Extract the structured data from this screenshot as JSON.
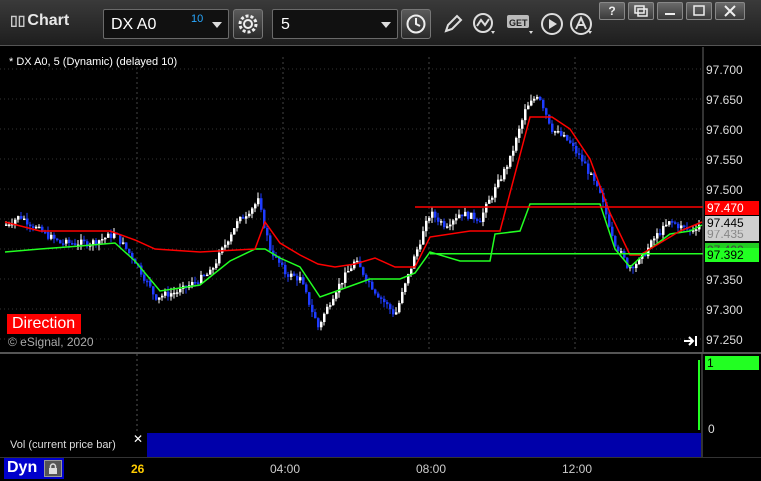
{
  "window": {
    "title": "Chart",
    "symbol": "DX A0",
    "symbol_superscript": "10",
    "interval": "5",
    "controls": [
      "minimize",
      "restore",
      "maximize",
      "close"
    ]
  },
  "toolbar_icons": [
    "settings-gear",
    "clock",
    "pencil",
    "indicator",
    "get",
    "play",
    "font"
  ],
  "get_label": "GET",
  "chart": {
    "legend": "* DX A0, 5 (Dynamic) (delayed 10)",
    "study_label": "Direction",
    "copyright": "© eSignal, 2020",
    "price_axis": [
      "97.700",
      "97.650",
      "97.600",
      "97.550",
      "97.500",
      "97.470",
      "97.445",
      "97.392",
      "97.350",
      "97.300",
      "97.250"
    ],
    "tags": {
      "red": "97.470",
      "white": "97.445",
      "green": "97.392",
      "hidden_grey": "97.435",
      "hidden_green": "97.400"
    },
    "colors": {
      "up_bar": "#ffffff",
      "down_bar": "#1e3cff",
      "red_line": "#ff0000",
      "green_line": "#22ff22",
      "volume_bar_bg": "#0000aa"
    }
  },
  "volume": {
    "label": "Vol (current price bar)",
    "close_glyph": "✕",
    "axis": [
      "1",
      "0"
    ]
  },
  "time_axis": {
    "day": "26",
    "labels": [
      "04:00",
      "08:00",
      "12:00"
    ]
  },
  "bottombar": {
    "mode": "Dyn"
  },
  "chart_data": {
    "type": "candlestick",
    "symbol": "DX A0",
    "interval": "5",
    "ylim": [
      97.25,
      97.7
    ],
    "x_labels": [
      "26",
      "04:00",
      "08:00",
      "12:00"
    ],
    "reference_lines": {
      "red": 97.47,
      "green": 97.392
    }
  }
}
